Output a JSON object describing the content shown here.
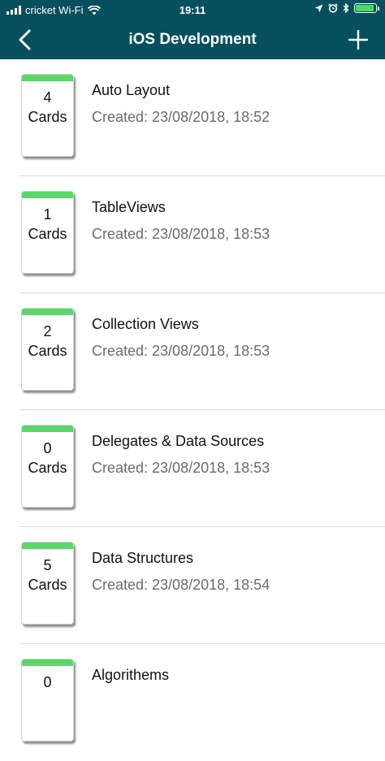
{
  "status_bar": {
    "carrier": "cricket Wi-Fi",
    "time": "19:11"
  },
  "nav": {
    "title": "iOS Development"
  },
  "colors": {
    "header": "#06505e",
    "stripe": "#5cd66a",
    "battery": "#4cd964"
  },
  "decks": [
    {
      "count": "4",
      "unit": "Cards",
      "title": "Auto Layout",
      "created": "Created: 23/08/2018, 18:52"
    },
    {
      "count": "1",
      "unit": "Cards",
      "title": "TableViews",
      "created": "Created: 23/08/2018, 18:53"
    },
    {
      "count": "2",
      "unit": "Cards",
      "title": "Collection Views",
      "created": "Created: 23/08/2018, 18:53"
    },
    {
      "count": "0",
      "unit": "Cards",
      "title": "Delegates & Data Sources",
      "created": "Created: 23/08/2018, 18:53"
    },
    {
      "count": "5",
      "unit": "Cards",
      "title": "Data Structures",
      "created": "Created: 23/08/2018, 18:54"
    },
    {
      "count": "0",
      "title": "Algorithems"
    }
  ]
}
